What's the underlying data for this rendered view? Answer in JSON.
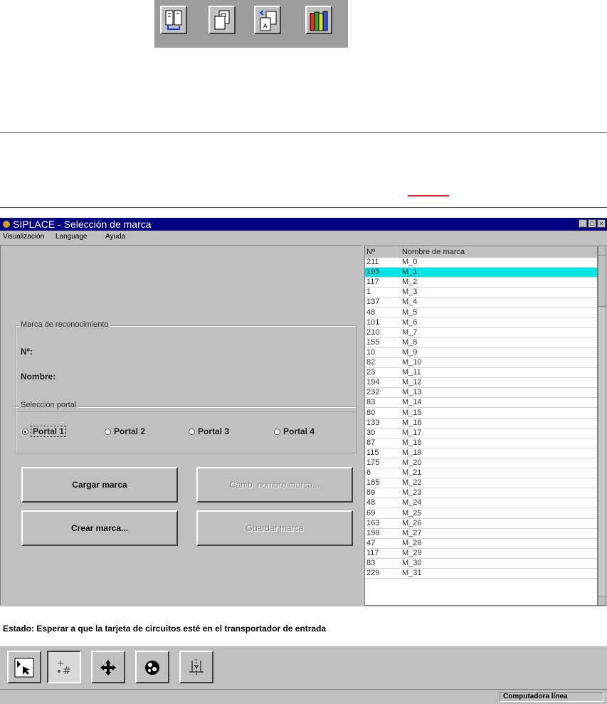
{
  "window": {
    "title": "SIPLACE - Selección de marca",
    "controls": [
      "_",
      "□",
      "×"
    ]
  },
  "menu": [
    "Visualización",
    "Language",
    "Ayuda"
  ],
  "top_icons": [
    "column-layout-icon",
    "copy-pages-icon",
    "transfer-document-icon",
    "books-library-icon"
  ],
  "recognition": {
    "group_label": "Marca de reconocimiento",
    "number_label": "Nº:",
    "name_label": "Nombre:"
  },
  "portal": {
    "group_label": "Selección portal",
    "options": [
      "Portal 1",
      "Portal 2",
      "Portal 3",
      "Portal 4"
    ],
    "selected": "Portal 1"
  },
  "buttons": {
    "load": "Cargar marca",
    "rename": "Camb. nombre marca...",
    "create": "Crear marca...",
    "save": "Guardar marca"
  },
  "list": {
    "col_no": "Nº",
    "col_name": "Nombre de marca",
    "selected_index": 1,
    "rows": [
      {
        "no": "211",
        "name": "M_0"
      },
      {
        "no": "195",
        "name": "M_1"
      },
      {
        "no": "117",
        "name": "M_2"
      },
      {
        "no": "1",
        "name": "M_3"
      },
      {
        "no": "137",
        "name": "M_4"
      },
      {
        "no": "48",
        "name": "M_5"
      },
      {
        "no": "101",
        "name": "M_6"
      },
      {
        "no": "210",
        "name": "M_7"
      },
      {
        "no": "155",
        "name": "M_8"
      },
      {
        "no": "10",
        "name": "M_9"
      },
      {
        "no": "82",
        "name": "M_10"
      },
      {
        "no": "23",
        "name": "M_11"
      },
      {
        "no": "194",
        "name": "M_12"
      },
      {
        "no": "232",
        "name": "M_13"
      },
      {
        "no": "83",
        "name": "M_14"
      },
      {
        "no": "80",
        "name": "M_15"
      },
      {
        "no": "133",
        "name": "M_16"
      },
      {
        "no": "30",
        "name": "M_17"
      },
      {
        "no": "87",
        "name": "M_18"
      },
      {
        "no": "115",
        "name": "M_19"
      },
      {
        "no": "175",
        "name": "M_20"
      },
      {
        "no": "6",
        "name": "M_21"
      },
      {
        "no": "185",
        "name": "M_22"
      },
      {
        "no": "89",
        "name": "M_23"
      },
      {
        "no": "48",
        "name": "M_24"
      },
      {
        "no": "69",
        "name": "M_25"
      },
      {
        "no": "163",
        "name": "M_26"
      },
      {
        "no": "198",
        "name": "M_27"
      },
      {
        "no": "47",
        "name": "M_28"
      },
      {
        "no": "117",
        "name": "M_29"
      },
      {
        "no": "83",
        "name": "M_30"
      },
      {
        "no": "229",
        "name": "M_31"
      }
    ]
  },
  "status": "Estado: Esperar a que la tarjeta de circuitos esté en el transportador de entrada",
  "tools": [
    "select-arrow-icon",
    "grid-marks-icon",
    "move-cross-icon",
    "vision-camera-icon",
    "axis-offset-icon"
  ],
  "status_panel": "Computadora línea",
  "colors": {
    "titlebar": "#000080",
    "selection": "#00e5e5",
    "face": "#c0c0c0",
    "accent_line": "#e02020"
  }
}
